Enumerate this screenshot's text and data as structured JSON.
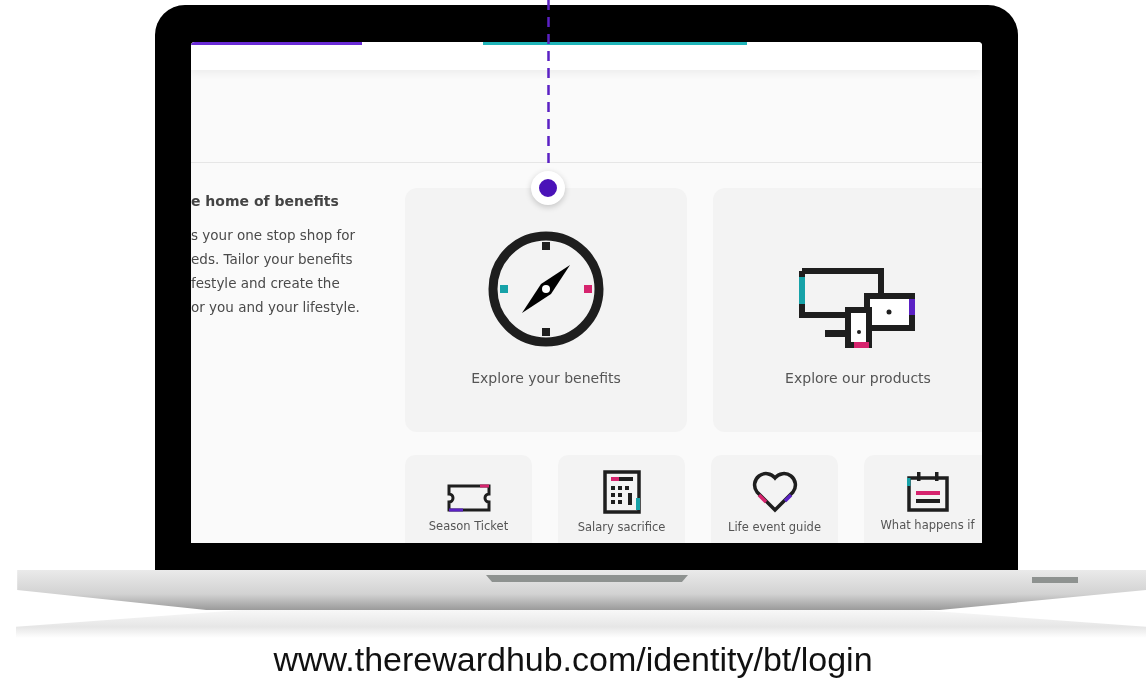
{
  "intro": {
    "heading": "e home of benefits",
    "lines": [
      "s your one stop shop for",
      "eds. Tailor your benefits",
      "festyle and create the",
      "or you and your lifestyle."
    ]
  },
  "feature_cards": [
    {
      "kind": "compass",
      "label": "Explore your benefits"
    },
    {
      "kind": "devices",
      "label": "Explore our products"
    }
  ],
  "quick_links": [
    {
      "kind": "ticket",
      "label": "Season Ticket"
    },
    {
      "kind": "calculator",
      "label": "Salary sacrifice"
    },
    {
      "kind": "heart",
      "label": "Life event guide"
    },
    {
      "kind": "calendar",
      "label": "What happens if"
    }
  ],
  "caption": "www.therewardhub.com/identity/bt/login"
}
